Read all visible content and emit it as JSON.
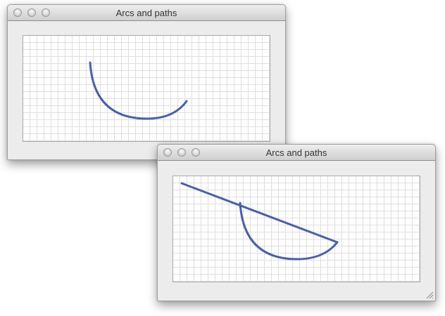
{
  "windows": [
    {
      "title": "Arcs and paths",
      "drawing": "arc"
    },
    {
      "title": "Arcs and paths",
      "drawing": "arc-with-line"
    }
  ],
  "stroke_color": "#4a5fa8",
  "grid_color": "#dedede"
}
